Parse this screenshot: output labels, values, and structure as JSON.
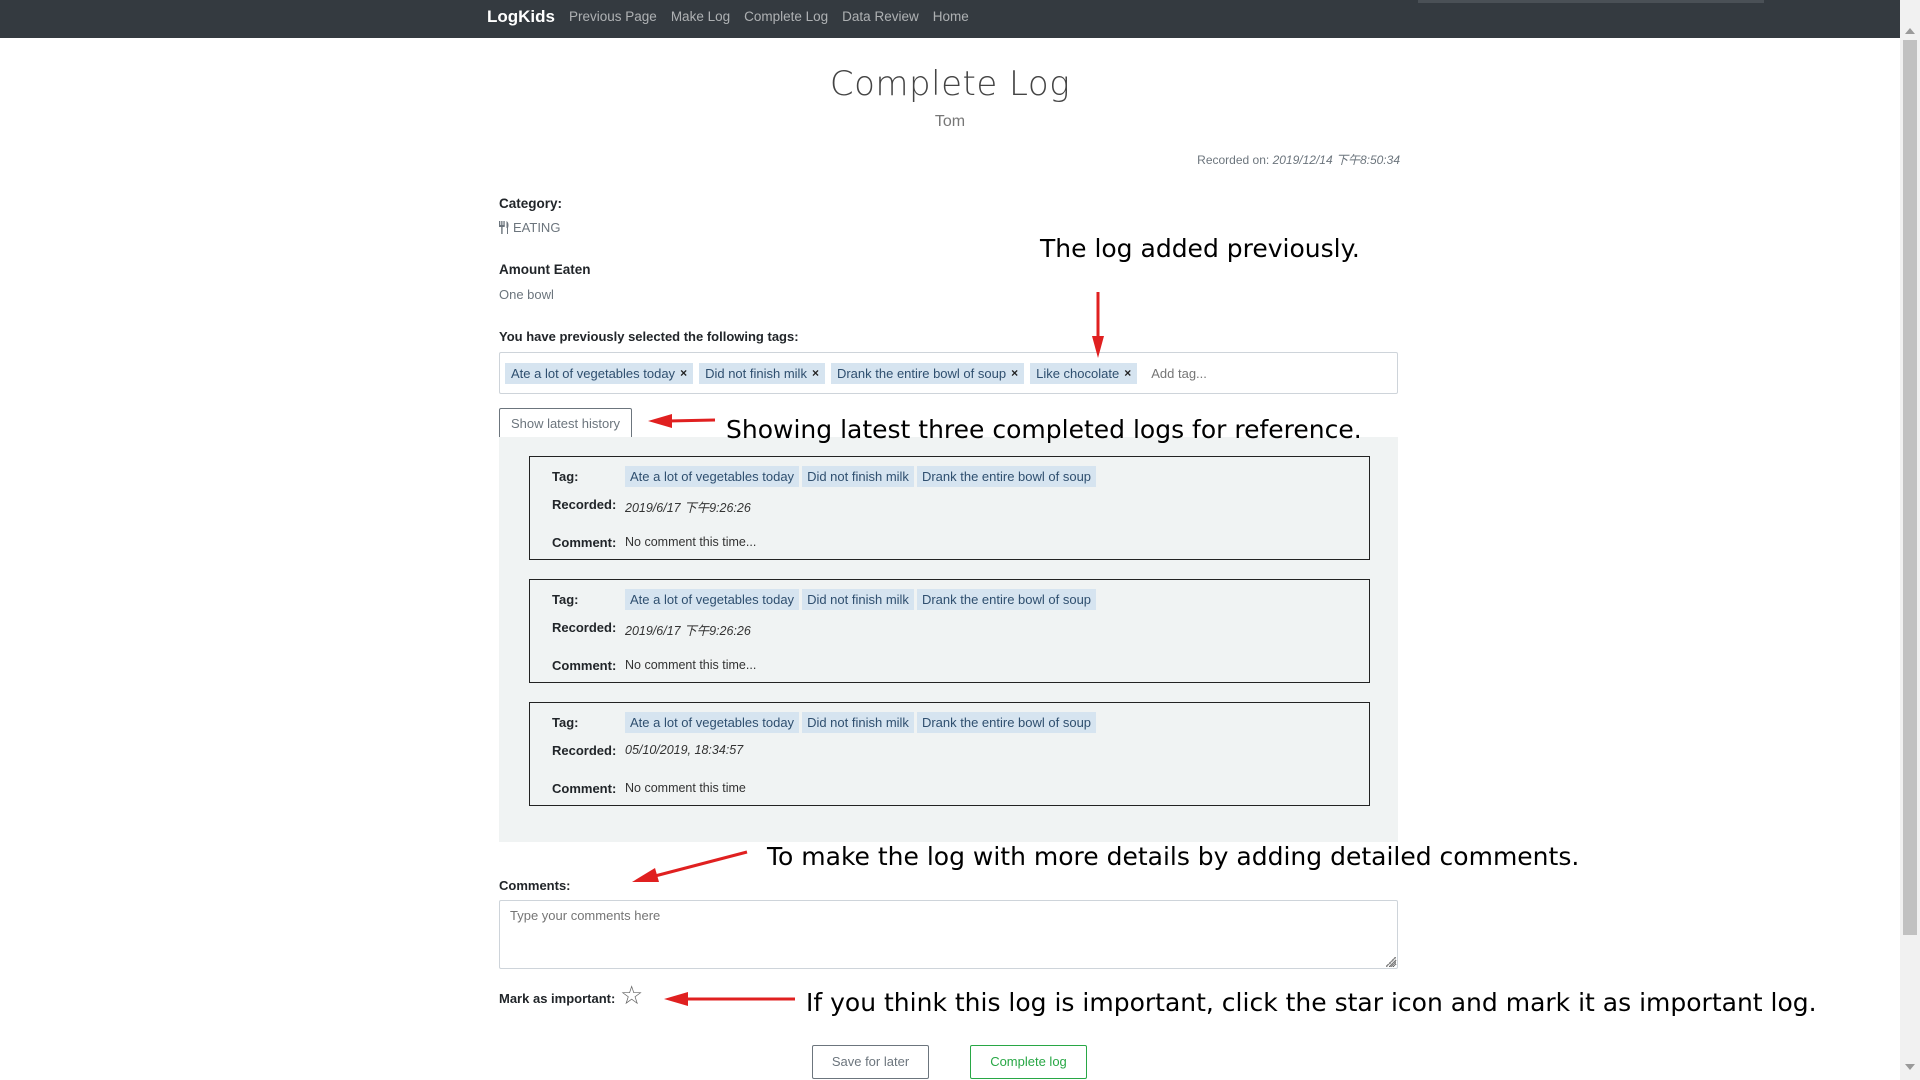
{
  "navbar": {
    "brand": "LogKids",
    "links": [
      "Previous Page",
      "Make Log",
      "Complete Log",
      "Data Review",
      "Home"
    ]
  },
  "header": {
    "title": "Complete Log",
    "subtitle": "Tom",
    "recorded_label": "Recorded on: ",
    "recorded_value": "2019/12/14 下午8:50:34"
  },
  "category": {
    "label": "Category:",
    "icon": "fork-knife-icon",
    "value": "EATING"
  },
  "amount": {
    "label": "Amount Eaten",
    "value": "One bowl"
  },
  "tags": {
    "label": "You have previously selected the following tags:",
    "items": [
      "Ate a lot of vegetables today",
      "Did not finish milk",
      "Drank the entire bowl of soup",
      "Like chocolate"
    ],
    "remove_glyph": "×",
    "add_placeholder": "Add tag..."
  },
  "history": {
    "button_label": "Show latest history",
    "tag_label": "Tag:",
    "recorded_label": "Recorded:",
    "comment_label": "Comment:",
    "entries": [
      {
        "tags": [
          "Ate a lot of vegetables today",
          "Did not finish milk",
          "Drank the entire bowl of soup"
        ],
        "recorded": "2019/6/17 下午9:26:26",
        "comment": "No comment this time..."
      },
      {
        "tags": [
          "Ate a lot of vegetables today",
          "Did not finish milk",
          "Drank the entire bowl of soup"
        ],
        "recorded": "2019/6/17 下午9:26:26",
        "comment": "No comment this time..."
      },
      {
        "tags": [
          "Ate a lot of vegetables today",
          "Did not finish milk",
          "Drank the entire bowl of soup"
        ],
        "recorded": "05/10/2019, 18:34:57",
        "comment": "No comment this time"
      }
    ]
  },
  "comments": {
    "label": "Comments:",
    "placeholder": "Type your comments here"
  },
  "important": {
    "label": "Mark as important:",
    "icon": "star-outline-icon"
  },
  "actions": {
    "save_label": "Save for later",
    "complete_label": "Complete log"
  },
  "annotations": {
    "log_added": "The log added previously.",
    "history_note": "Showing latest three completed logs for reference.",
    "comments_note": "To make the log with more details by adding detailed comments.",
    "important_note": "If you think this log is important, click the star icon and mark it as important log."
  },
  "colors": {
    "navbar": "#343a40",
    "chip_bg": "#d6e4f0",
    "panel_bg": "#f0f3f3",
    "complete_button": "#28a745",
    "annotation_arrow": "#e02020"
  }
}
